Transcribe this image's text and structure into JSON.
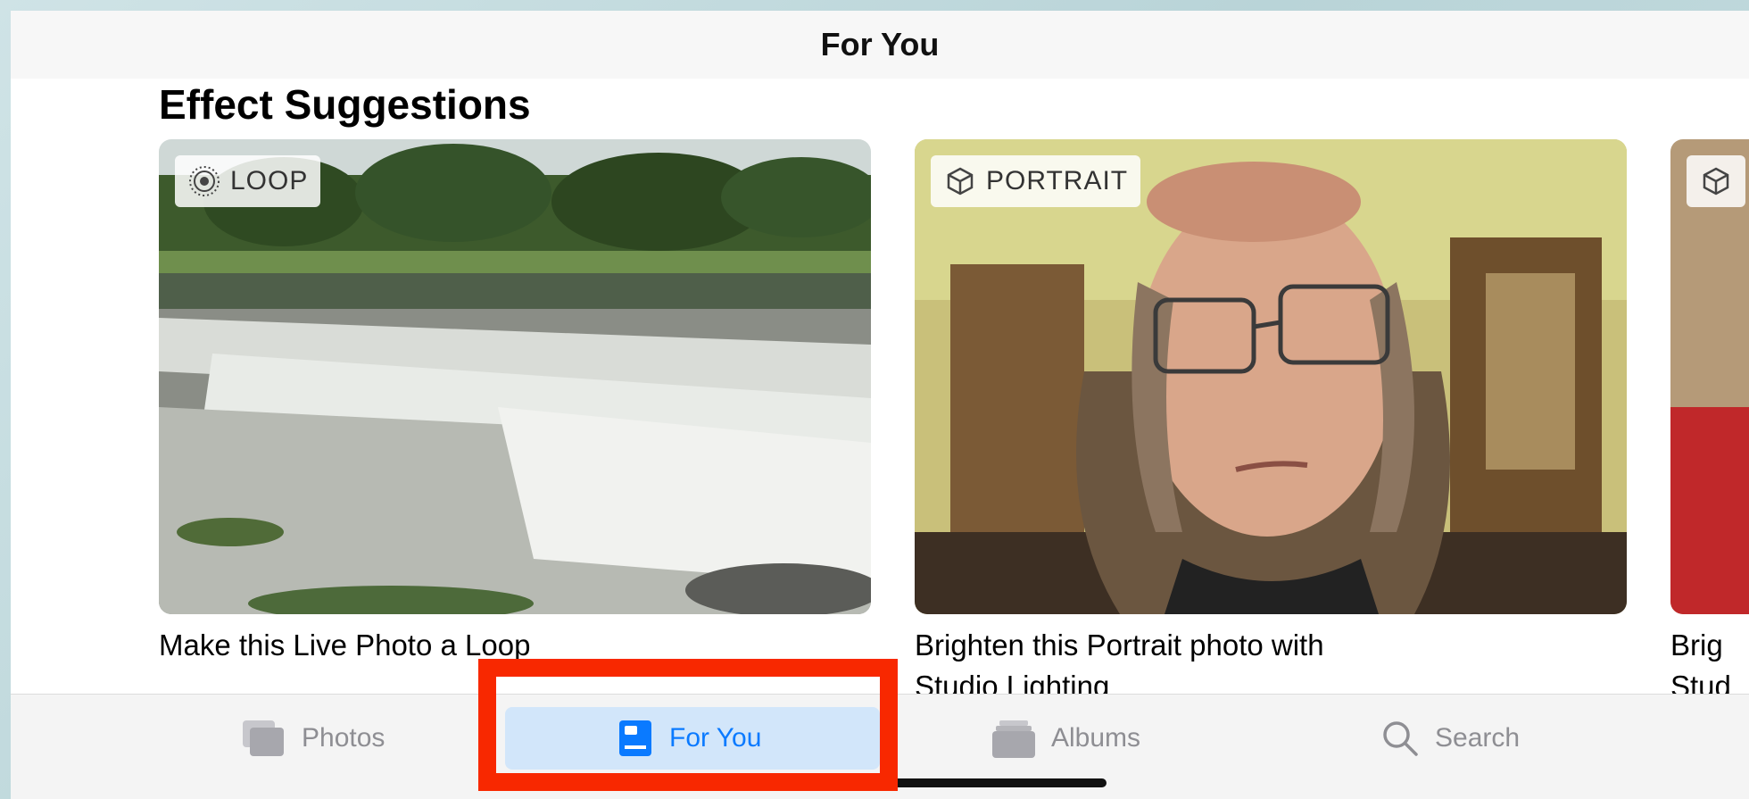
{
  "nav": {
    "title": "For You"
  },
  "section": {
    "title": "Effect Suggestions"
  },
  "cards": [
    {
      "badge": "LOOP",
      "badge_icon": "live-photo-icon",
      "caption": "Make this Live Photo a Loop"
    },
    {
      "badge": "PORTRAIT",
      "badge_icon": "cube-icon",
      "caption_line1": "Brighten this Portrait photo with",
      "caption_line2": "Studio Lighting"
    },
    {
      "caption_line1": "Brig",
      "caption_line2": "Stud"
    }
  ],
  "tabs": [
    {
      "label": "Photos",
      "icon": "photos-stack-icon",
      "active": false
    },
    {
      "label": "For You",
      "icon": "for-you-icon",
      "active": true
    },
    {
      "label": "Albums",
      "icon": "albums-icon",
      "active": false
    },
    {
      "label": "Search",
      "icon": "search-icon",
      "active": false
    }
  ],
  "colors": {
    "accent": "#0a7aff",
    "active_tab_bg": "#d2e6fa",
    "highlight": "#f82800"
  }
}
